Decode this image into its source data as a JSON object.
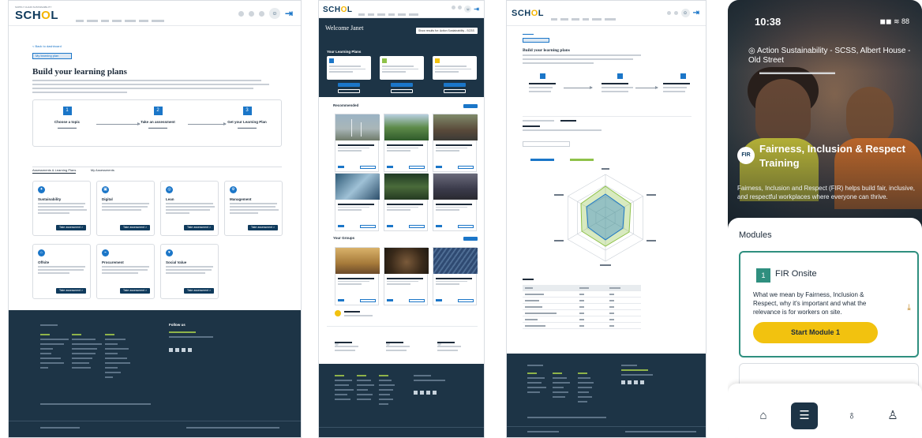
{
  "panel1": {
    "logo": "SCHOL",
    "logo_small": "SUPPLY CHAIN SUSTAINABILITY",
    "back_link": "< Back to dashboard",
    "chip": "My learning plan",
    "title": "Build your learning plans",
    "steps": [
      {
        "num": "1",
        "title": "Choose a topic"
      },
      {
        "num": "2",
        "title": "Take an assessment"
      },
      {
        "num": "3",
        "title": "Get your Learning Plan"
      }
    ],
    "tabs": [
      "Assessments & Learning Plans",
      "My Assessments"
    ],
    "cards": [
      {
        "title": "Sustainability",
        "button": "Take assessment >"
      },
      {
        "title": "Digital",
        "button": "Take assessment >"
      },
      {
        "title": "Lean",
        "button": "Take assessment >"
      },
      {
        "title": "Management",
        "button": "Take assessment >"
      },
      {
        "title": "Offsite",
        "button": "Take assessment >"
      },
      {
        "title": "Procurement",
        "button": "Take assessment >"
      },
      {
        "title": "Social Value",
        "button": "Take assessment >"
      }
    ],
    "footer_follow": "Follow us"
  },
  "panel2": {
    "logo": "SCHOL",
    "hero_title": "Welcome Janet",
    "select_label": "Show results for: Action Sustainability - SCSS",
    "sections": [
      "Your Learning Plans",
      "Recommended",
      "Your Groups"
    ]
  },
  "panel3": {
    "logo": "SCHOL",
    "title": "Build your learning plans",
    "colors": {
      "series1": "#1b76c8",
      "series2": "#8fc24a"
    }
  },
  "panel4": {
    "time": "10:38",
    "status": "◼◼ ≋ 88",
    "location": "Action Sustainability - SCSS, Albert House - Old Street",
    "badge": "FIR",
    "course_title": "Fairness, Inclusion & Respect Training",
    "course_desc": "Fairness, Inclusion and Respect (FIR) helps build fair, inclusive, and respectful workplaces where everyone can thrive.",
    "modules_heading": "Modules",
    "module": {
      "num": "1",
      "name": "FIR Onsite",
      "desc": "What we mean by Fairness, Inclusion & Respect, why it's important and what the relevance is for workers on site.",
      "cta": "Start Module 1"
    },
    "tabs": [
      "home-icon",
      "modules-icon",
      "award-icon",
      "profile-icon"
    ],
    "colors": {
      "accent": "#2f8f7f",
      "cta": "#f2c20f",
      "dark": "#1d3446"
    }
  }
}
